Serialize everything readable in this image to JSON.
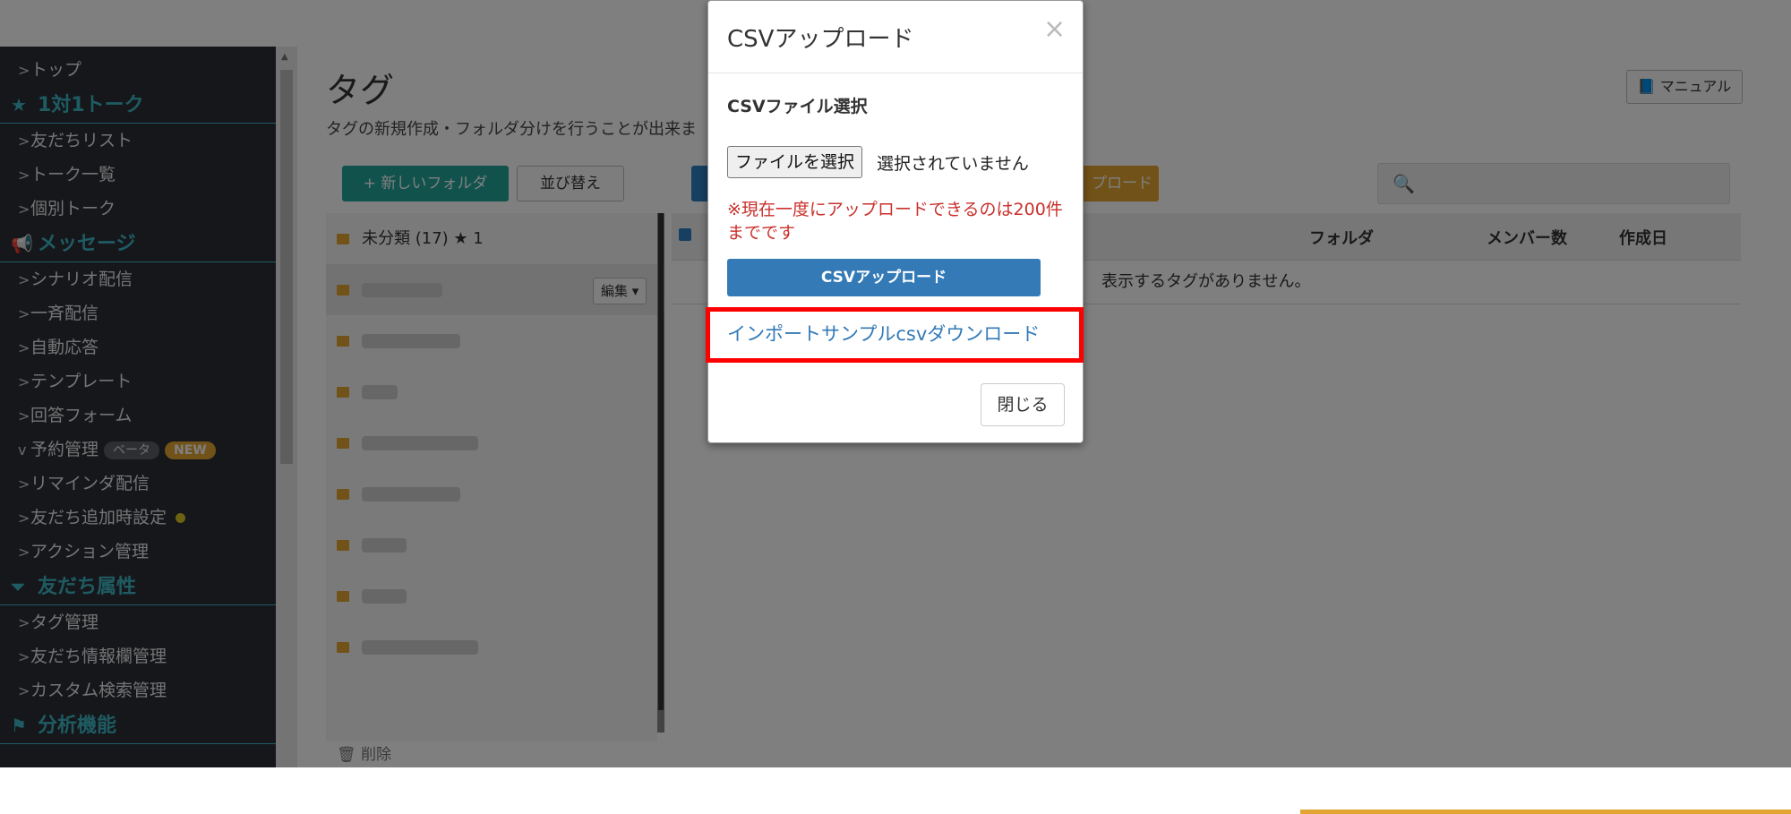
{
  "sidebar": {
    "items": [
      {
        "type": "item",
        "label": "トップ",
        "chevron": ">"
      },
      {
        "type": "head",
        "label": "1対1トーク",
        "icon": "star-icon",
        "glyph": "★"
      },
      {
        "type": "item",
        "label": "友だちリスト",
        "chevron": ">"
      },
      {
        "type": "item",
        "label": "トーク一覧",
        "chevron": ">"
      },
      {
        "type": "item",
        "label": "個別トーク",
        "chevron": ">"
      },
      {
        "type": "head",
        "label": "メッセージ",
        "icon": "megaphone-icon",
        "glyph": "📢"
      },
      {
        "type": "item",
        "label": "シナリオ配信",
        "chevron": ">"
      },
      {
        "type": "item",
        "label": "一斉配信",
        "chevron": ">"
      },
      {
        "type": "item",
        "label": "自動応答",
        "chevron": ">"
      },
      {
        "type": "item",
        "label": "テンプレート",
        "chevron": ">"
      },
      {
        "type": "item",
        "label": "回答フォーム",
        "chevron": ">"
      },
      {
        "type": "item",
        "label": "予約管理",
        "chevron": "v",
        "badges": [
          "ベータ",
          "NEW"
        ]
      },
      {
        "type": "item",
        "label": "リマインダ配信",
        "chevron": ">"
      },
      {
        "type": "item",
        "label": "友だち追加時設定",
        "chevron": ">",
        "dot": true
      },
      {
        "type": "item",
        "label": "アクション管理",
        "chevron": ">"
      },
      {
        "type": "head",
        "label": "友だち属性",
        "icon": "filter-icon",
        "glyph": "⏷"
      },
      {
        "type": "item",
        "label": "タグ管理",
        "chevron": ">"
      },
      {
        "type": "item",
        "label": "友だち情報欄管理",
        "chevron": ">"
      },
      {
        "type": "item",
        "label": "カスタム検索管理",
        "chevron": ">"
      },
      {
        "type": "head",
        "label": "分析機能",
        "icon": "flag-icon",
        "glyph": "⚑"
      }
    ]
  },
  "main": {
    "title": "タグ",
    "description": "タグの新規作成・フォルダ分けを行うことが出来ま",
    "manual_label": "📘 マニュアル",
    "new_folder_label": "+ 新しいフォルダ",
    "sort_label": "並び替え",
    "csv_upload_partial": "プロード",
    "search_icon": "🔍",
    "folders": [
      {
        "label": "未分類 (17) ★ 1",
        "blurred": false
      },
      {
        "label": "",
        "blurred": true,
        "active": true,
        "edit_label": "編集 ▾"
      },
      {
        "label": "",
        "blurred": true
      },
      {
        "label": "",
        "blurred": true
      },
      {
        "label": "",
        "blurred": true
      },
      {
        "label": "",
        "blurred": true
      },
      {
        "label": "",
        "blurred": true
      },
      {
        "label": "",
        "blurred": true
      },
      {
        "label": "",
        "blurred": true
      }
    ],
    "table_headers": {
      "folder": "フォルダ",
      "members": "メンバー数",
      "created": "作成日"
    },
    "empty_message": "表示するタグがありません。",
    "delete_label": "🗑 削除"
  },
  "modal": {
    "title": "CSVアップロード",
    "close_glyph": "×",
    "section_label": "CSVファイル選択",
    "file_button": "ファイルを選択",
    "file_status": "選択されていません",
    "warning": "※現在一度にアップロードできるのは200件までです",
    "upload_button": "CSVアップロード",
    "sample_link": "インポートサンプルcsvダウンロード",
    "close_button": "閉じる"
  },
  "colors": {
    "sidebar_bg": "#2b2f36",
    "accent_teal": "#3fb6c4",
    "primary": "#337ab7",
    "warning": "#c9302c",
    "highlight": "#ff0000"
  }
}
